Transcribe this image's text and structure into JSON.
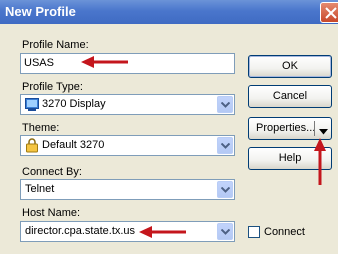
{
  "window": {
    "title": "New Profile"
  },
  "form": {
    "profile_name": {
      "label": "Profile Name:",
      "value": "USAS"
    },
    "profile_type": {
      "label": "Profile Type:",
      "value": "3270 Display",
      "icon": "terminal-icon"
    },
    "theme": {
      "label": "Theme:",
      "value": "Default 3270",
      "icon": "lock-icon"
    },
    "connect_by": {
      "label": "Connect By:",
      "value": "Telnet"
    },
    "host_name": {
      "label": "Host Name:",
      "value": "director.cpa.state.tx.us"
    }
  },
  "buttons": {
    "ok": "OK",
    "cancel": "Cancel",
    "properties": "Properties...",
    "help": "Help"
  },
  "connect_checkbox": {
    "label": "Connect",
    "checked": false
  },
  "colors": {
    "annotation_arrow": "#c4161c",
    "titlebar": "#4a76cc",
    "dialog_bg": "#ece9d8"
  }
}
